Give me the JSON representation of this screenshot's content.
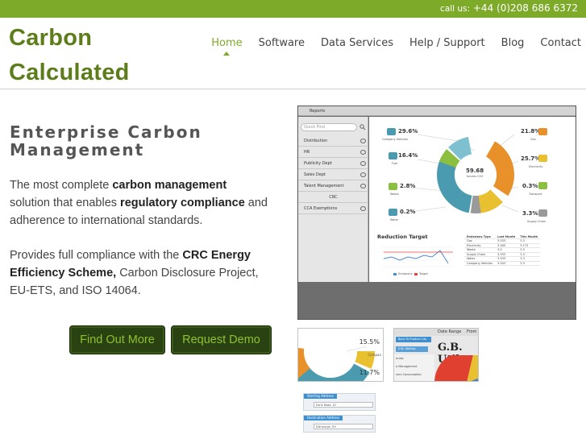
{
  "topbar": {
    "label": "call us:",
    "phone": "+44 (0)208 686 6372"
  },
  "logo": {
    "line1": "Carbon",
    "line2": "Calculated"
  },
  "nav": {
    "items": [
      {
        "label": "Home",
        "active": true
      },
      {
        "label": "Software"
      },
      {
        "label": "Data Services"
      },
      {
        "label": "Help / Support"
      },
      {
        "label": "Blog"
      },
      {
        "label": "Contact"
      }
    ]
  },
  "hero": {
    "title_line1": "Enterprise Carbon",
    "title_line2": "Management",
    "p1": {
      "a": "The most complete ",
      "b": "carbon management",
      "c": " solution that enables ",
      "d": "regulatory compliance",
      "e": " and adherence to international standards."
    },
    "p2": {
      "a": "Provides full compliance with the ",
      "b": "CRC Energy Efficiency Scheme,",
      "c": " Carbon Disclosure Project, EU-ETS, and ISO 14064."
    },
    "buttons": {
      "find_out_more": "Find Out More",
      "request_demo": "Request Demo"
    }
  },
  "app_screenshot": {
    "window_title": "Reports",
    "search_placeholder": "Quick Find",
    "sidebar_items": [
      "Distribution",
      "HR",
      "Publicity Dept",
      "Sales Dept",
      "Talent Management",
      "CRC",
      "CCA Exemptions"
    ],
    "donut_center": {
      "value": "59.68",
      "label": "tonnes CO2"
    },
    "stats": [
      {
        "value": "29.6%",
        "label": "Company Vehicles"
      },
      {
        "value": "16.4%",
        "label": "Fuel"
      },
      {
        "value": "2.8%",
        "label": "Waste"
      },
      {
        "value": "0.2%",
        "label": "Water"
      },
      {
        "value": "21.8%",
        "label": "Gas"
      },
      {
        "value": "25.7%",
        "label": "Electricity"
      },
      {
        "value": "0.3%",
        "label": "Transport"
      },
      {
        "value": "3.3%",
        "label": "Supply Chain"
      }
    ],
    "reduction_title": "Reduction Target",
    "reduction_legend": [
      "Emissions",
      "Target"
    ],
    "table": {
      "headers": [
        "Emissions Type",
        "Last Month",
        "This Month"
      ],
      "rows": [
        [
          "Gas",
          "3.533",
          "3.3"
        ],
        [
          "Electricity",
          "3.495",
          "3.173"
        ],
        [
          "Waste",
          "3.0",
          "3.3"
        ],
        [
          "Supply Chain",
          "3.533",
          "3.3"
        ],
        [
          "Water",
          "3.533",
          "3.3"
        ],
        [
          "Company Vehicles",
          "3.543",
          "3.3"
        ]
      ]
    },
    "colors": {
      "teal": "#4a9bb0",
      "orange": "#e8902a",
      "yellow": "#e8c030",
      "green": "#8cbf3f",
      "gray": "#9a9a9a"
    }
  },
  "thumbnails": {
    "t1": {
      "pct_a": "15.5%",
      "label_a": "Compan",
      "pct_b": "11.7%"
    },
    "t2": {
      "header_a": "Date Range",
      "header_b": "From",
      "back_label": "Back To Product List",
      "tab_label": "G.B. Utilities",
      "title": "G.B. Util",
      "rows": [
        "erials",
        "e Management",
        "vers Consumption"
      ]
    },
    "t3": {
      "field1": "Starting Address",
      "value1": "Earls Road, A7",
      "field2": "Destination Address",
      "value2": "Edinburgh, EH"
    }
  }
}
